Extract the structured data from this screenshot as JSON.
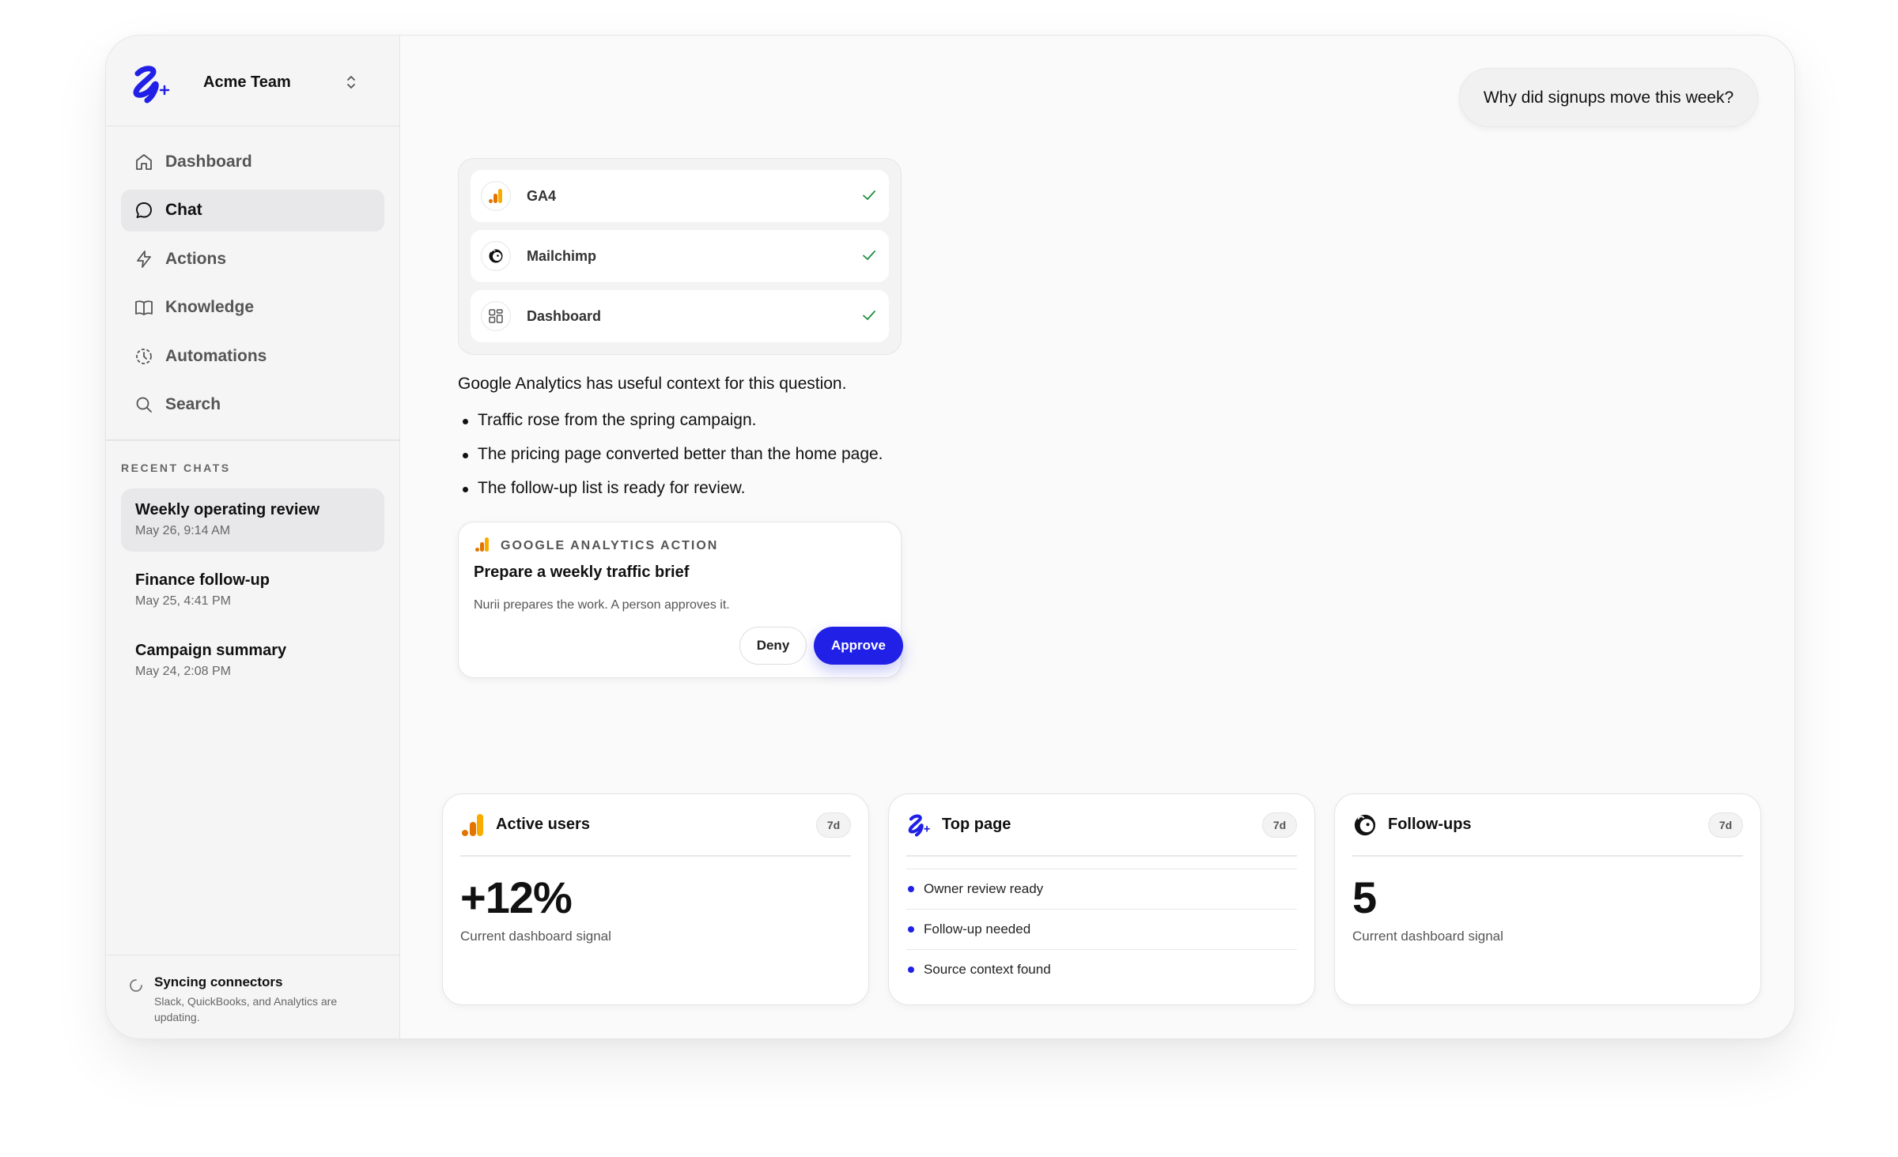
{
  "sidebar": {
    "team_name": "Acme Team",
    "nav": [
      {
        "label": "Dashboard",
        "icon": "home-icon"
      },
      {
        "label": "Chat",
        "icon": "chat-bubble-icon",
        "active": true
      },
      {
        "label": "Actions",
        "icon": "lightning-icon"
      },
      {
        "label": "Knowledge",
        "icon": "book-icon"
      },
      {
        "label": "Automations",
        "icon": "clock-icon"
      },
      {
        "label": "Search",
        "icon": "search-icon"
      }
    ],
    "recent_title": "RECENT CHATS",
    "recent": [
      {
        "title": "Weekly operating review",
        "date": "May 26, 9:14 AM",
        "active": true
      },
      {
        "title": "Finance follow-up",
        "date": "May 25, 4:41 PM"
      },
      {
        "title": "Campaign summary",
        "date": "May 24, 2:08 PM"
      }
    ],
    "sync": {
      "title": "Syncing connectors",
      "desc": "Slack, QuickBooks, and Analytics are updating."
    }
  },
  "chat": {
    "user_message": "Why did signups move this week?",
    "sources": [
      {
        "label": "GA4",
        "icon": "analytics-bars-icon",
        "status": "checked"
      },
      {
        "label": "Mailchimp",
        "icon": "mailchimp-icon",
        "status": "checked"
      },
      {
        "label": "Dashboard",
        "icon": "grid-icon",
        "status": "checked"
      }
    ],
    "answer_intro": "Google Analytics has useful context for this question.",
    "answer_points": [
      "Traffic rose from the spring campaign.",
      "The pricing page converted better than the home page.",
      "The follow-up list is ready for review."
    ],
    "action": {
      "tag": "GOOGLE ANALYTICS ACTION",
      "title": "Prepare a weekly traffic brief",
      "desc": "Nurii prepares the work. A person approves it.",
      "deny": "Deny",
      "approve": "Approve"
    }
  },
  "cards": [
    {
      "title": "Active users",
      "period": "7d",
      "value": "+12%",
      "sub": "Current dashboard signal",
      "icon": "analytics-bars-icon"
    },
    {
      "title": "Top page",
      "period": "7d",
      "items": [
        "Owner review ready",
        "Follow-up needed",
        "Source context found"
      ],
      "icon": "brand-logo-icon"
    },
    {
      "title": "Follow-ups",
      "period": "7d",
      "value": "5",
      "sub": "Current dashboard signal",
      "icon": "mailchimp-icon"
    }
  ],
  "colors": {
    "accent": "#2020e6",
    "ga_orange": "#f9ab00",
    "ga_dark_orange": "#e37400",
    "check_green": "#1e8e3e"
  }
}
